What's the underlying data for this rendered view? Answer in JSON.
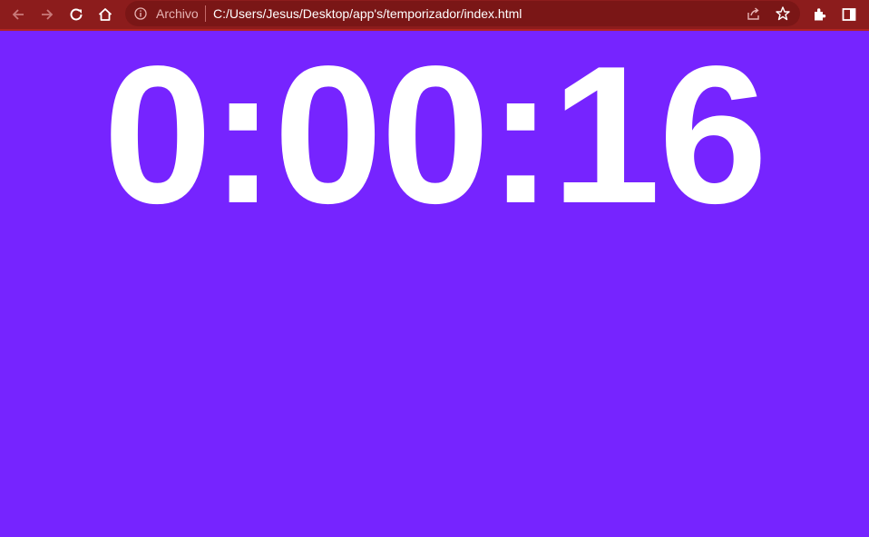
{
  "browser": {
    "scheme_label": "Archivo",
    "url": "C:/Users/Jesus/Desktop/app's/temporizador/index.html",
    "toolbar_color": "#8c1c1c"
  },
  "page": {
    "timer_text": "0:00:16",
    "background_color": "#7624ff",
    "text_color": "#ffffff"
  },
  "icons": [
    "back-icon",
    "forward-icon",
    "reload-icon",
    "home-icon",
    "info-icon",
    "share-icon",
    "star-icon",
    "extensions-icon",
    "side-panel-icon"
  ]
}
